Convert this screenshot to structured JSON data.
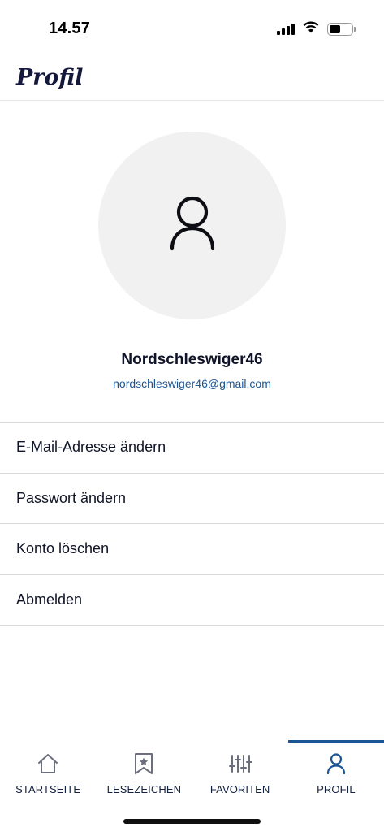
{
  "status_bar": {
    "time": "14.57",
    "icons": [
      "signal-icon",
      "wifi-icon",
      "battery-icon"
    ],
    "battery_level": 0.5
  },
  "header": {
    "title": "Profil"
  },
  "profile": {
    "avatar_icon": "user-icon",
    "name": "Nordschleswiger46",
    "email": "nordschleswiger46@gmail.com"
  },
  "menu": {
    "items": [
      {
        "label": "E-Mail-Adresse ändern"
      },
      {
        "label": "Passwort ändern"
      },
      {
        "label": "Konto löschen"
      },
      {
        "label": "Abmelden"
      }
    ]
  },
  "tabbar": {
    "active": "PROFIL",
    "tabs": [
      {
        "label": "STARTSEITE",
        "icon": "home-icon"
      },
      {
        "label": "LESEZEICHEN",
        "icon": "bookmark-star-icon"
      },
      {
        "label": "FAVORITEN",
        "icon": "sliders-icon"
      },
      {
        "label": "PROFIL",
        "icon": "user-icon"
      }
    ]
  },
  "colors": {
    "accent": "#1a5596",
    "title": "#14183a",
    "avatar_bg": "#f1f1f1"
  }
}
